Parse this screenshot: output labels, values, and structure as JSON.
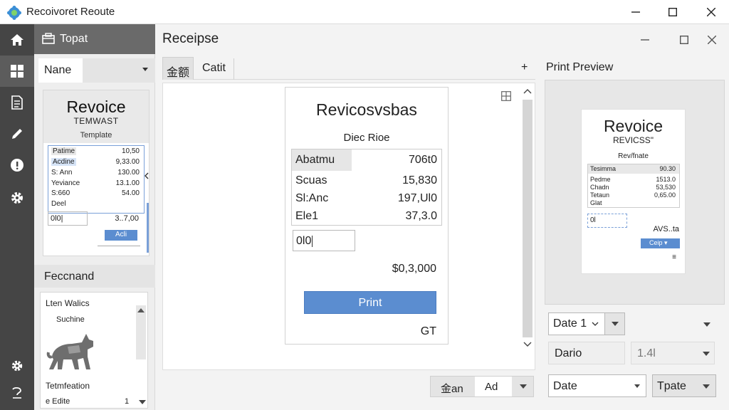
{
  "window": {
    "title": "Recoivoret Reoute"
  },
  "rail": {
    "icons": [
      "home-icon",
      "dashboard-icon",
      "document-icon",
      "edit-icon",
      "info-icon",
      "settings-icon",
      "settings-icon",
      "help-icon"
    ]
  },
  "left_panel": {
    "header": "Topat",
    "name_select": "Nane",
    "template": {
      "brand": "Revoice",
      "subtitle": "TEMWAST",
      "tag": "Template",
      "rows": [
        {
          "label": "Patime",
          "value": "10,50"
        },
        {
          "label": "Acdine",
          "value": "9,33.00"
        },
        {
          "label": "S: Ann",
          "value": "130.00"
        },
        {
          "label": "Yeviance",
          "value": "13.1.00"
        },
        {
          "label": "S:660",
          "value": "54.00"
        },
        {
          "label": "Deel",
          "value": ""
        }
      ],
      "input_value": "0l0|",
      "total": "3..7,00",
      "button": "Acli"
    },
    "feed": {
      "header": "Feccnand",
      "title": "Lten Walics",
      "subtitle": "Suchine",
      "footer": "Tetmfeation",
      "footer2": "e  Edite",
      "count": "1"
    }
  },
  "main": {
    "title": "Receipse",
    "tabs": [
      {
        "label": "金额"
      },
      {
        "label": "Catit"
      }
    ],
    "tab_add": "+",
    "receipt": {
      "title": "Revicosvsbas",
      "subtitle": "Diec Rioe",
      "header_label": "Abatmu",
      "header_value": "706t0",
      "rows": [
        {
          "label": "Scuas",
          "value": "15,830"
        },
        {
          "label": "Sl:Anc",
          "value": "197,Ul0"
        },
        {
          "label": "Ele1",
          "value": "37,3.0"
        }
      ],
      "input_value": "0l0",
      "total": "$0,3,000",
      "print_button": "Print",
      "footer": "GT"
    },
    "bottom": {
      "left": "金an",
      "right": "Ad"
    }
  },
  "print_preview": {
    "label": "Print Preview",
    "brand": "Revoice",
    "subtitle": "REVICSS\"",
    "tag": "Rev/fnate",
    "rows": [
      {
        "label": "Tesimma",
        "value": "90.30"
      },
      {
        "label": "Pedme",
        "value": "1513.0"
      },
      {
        "label": "Chadn",
        "value": "53,530"
      },
      {
        "label": "Tetaun",
        "value": "0,65.00"
      },
      {
        "label": "Glat",
        "value": ""
      }
    ],
    "input_value": "0l",
    "total": "AVS..ta",
    "button": "Ceip",
    "footer": "≡",
    "controls": {
      "date_select": "Date 1",
      "dario": "Dario",
      "mid_value": "1.4l",
      "date_field": "Date",
      "tpate": "Tpate"
    }
  }
}
